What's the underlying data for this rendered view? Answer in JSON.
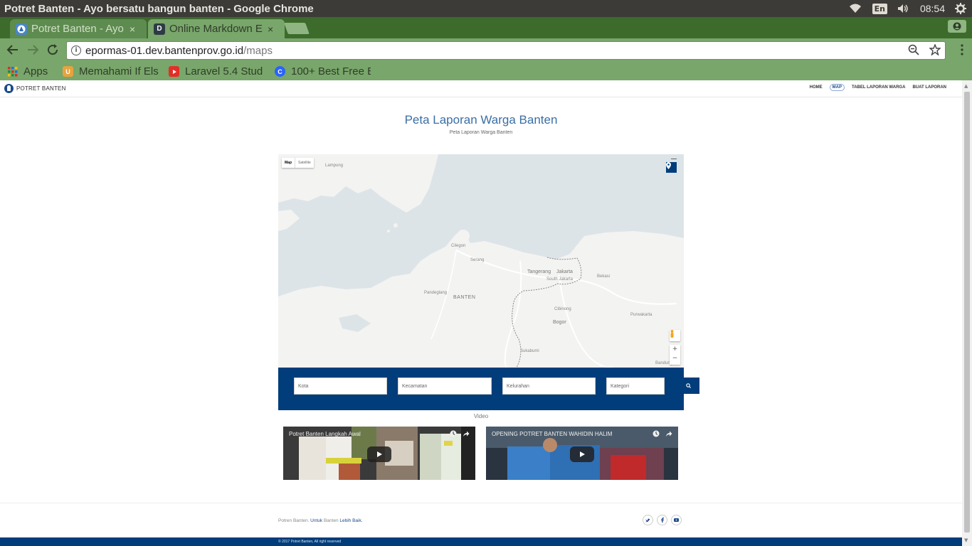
{
  "os": {
    "window_title": "Potret Banten - Ayo bersatu bangun banten - Google Chrome",
    "input_lang": "En",
    "time": "08:54"
  },
  "tabs": [
    {
      "label": "Potret Banten - Ayo",
      "close": "×"
    },
    {
      "label": "Online Markdown E",
      "favicon": "D",
      "close": "×"
    }
  ],
  "omnibox": {
    "host": "epormas-01.dev.bantenprov.go.id",
    "path": "/maps"
  },
  "bookmarks": [
    {
      "label": "Apps"
    },
    {
      "label": "Memahami If Else",
      "favicon": "U"
    },
    {
      "label": "Laravel 5.4 Stud"
    },
    {
      "label": "100+ Best Free B",
      "favicon": "C"
    }
  ],
  "site": {
    "brand": "POTRET BANTEN",
    "nav": [
      "HOME",
      "MAP",
      "TABEL LAPORAN WARGA",
      "BUAT LAPORAN"
    ],
    "title": "Peta Laporan Warga Banten",
    "subtitle": "Peta Laporan Warga Banten"
  },
  "map": {
    "type_options": [
      "Map",
      "Satellite"
    ],
    "labels": {
      "cilegon": "Cilegon",
      "serang": "Serang",
      "banten": "BANTEN",
      "tangerang": "Tangerang",
      "jakarta": "Jakarta",
      "south_jakarta": "South Jakarta",
      "bekasi": "Bekasi",
      "bogor": "Bogor",
      "purwakarta": "Purwakarta",
      "bandung": "Bandung",
      "lampung": "Lampung",
      "pandeglang": "Pandeglang",
      "cibinong": "Cibinong",
      "sukabumi": "Sukabumi"
    },
    "zoom_in": "+",
    "zoom_out": "−"
  },
  "filters": {
    "kota": "Kota",
    "kecamatan": "Kecamatan",
    "kelurahan": "Kelurahan",
    "kategori": "Kategori"
  },
  "video_section": {
    "label": "Video",
    "videos": [
      {
        "title": "Potret Banten Langkah Awal"
      },
      {
        "title": "OPENING POTRET BANTEN WAHIDIN HALIM"
      }
    ]
  },
  "footer": {
    "part1": "Potren Banten. ",
    "part2": "Untuk",
    "part3": " Banten ",
    "part4": "Lebih Baik.",
    "copyright": "© 2017 Potret Banten, All right reserved"
  },
  "colors": {
    "brand_blue": "#003d7a",
    "title_blue": "#3a6ea5",
    "chrome_green": "#79a66a"
  }
}
